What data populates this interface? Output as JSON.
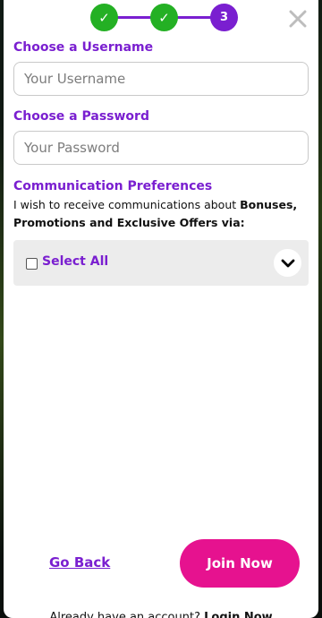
{
  "stepper": {
    "steps": [
      {
        "label": "✓",
        "state": "done"
      },
      {
        "label": "✓",
        "state": "done"
      },
      {
        "label": "3",
        "state": "current"
      }
    ],
    "close_icon": "×"
  },
  "username": {
    "label": "Choose a Username",
    "placeholder": "Your Username",
    "value": ""
  },
  "password": {
    "label": "Choose a Password",
    "placeholder": "Your Password",
    "value": ""
  },
  "communication": {
    "heading": "Communication Preferences",
    "text_prefix": "I wish to receive communications about ",
    "text_bold": "Bonuses, Promotions and Exclusive Offers via:",
    "select_all_label": "Select All",
    "select_all_checked": false
  },
  "actions": {
    "go_back": "Go Back",
    "join_now": "Join Now"
  },
  "footer": {
    "text": "Already have an account? ",
    "link": "Login Now"
  },
  "colors": {
    "accent": "#7a1fd0",
    "success": "#24b024",
    "cta": "#e6128f"
  }
}
